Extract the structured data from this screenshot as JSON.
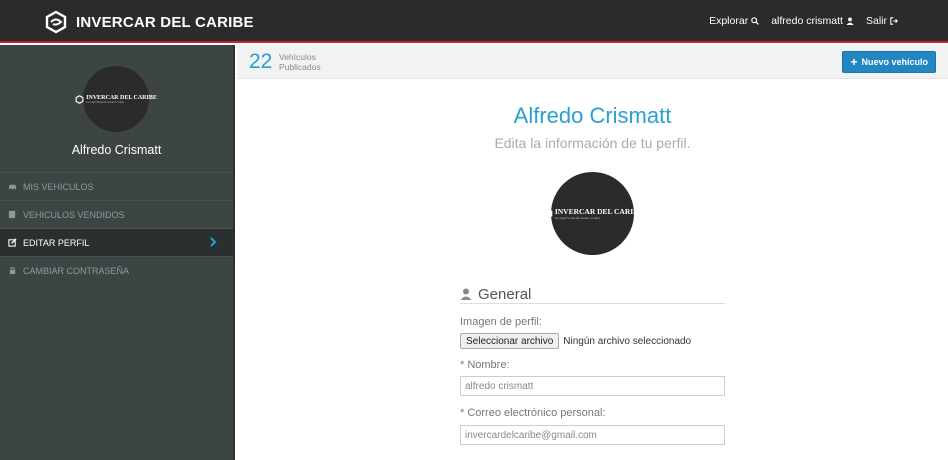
{
  "topbar": {
    "brand": "INVERCAR DEL CARIBE",
    "nav": {
      "explore": "Explorar",
      "user": "alfredo crismatt",
      "logout": "Salir"
    }
  },
  "sidebar": {
    "avatar_logo": {
      "main": "INVERCAR DEL CARIBE",
      "sub": "La mejor forma de vender tu carro"
    },
    "user_name": "Alfredo Crismatt",
    "items": [
      {
        "label": "MIS VEHICULOS",
        "icon": "car-icon"
      },
      {
        "label": "VEHICULOS VENDIDOS",
        "icon": "book-icon"
      },
      {
        "label": "EDITAR PERFIL",
        "icon": "edit-icon",
        "active": true
      },
      {
        "label": "CAMBIAR CONTRASEÑA",
        "icon": "lock-icon"
      }
    ]
  },
  "subheader": {
    "count": "22",
    "count_line1": "Vehículos",
    "count_line2": "Publicados",
    "new_button": "Nuevo vehículo"
  },
  "profile": {
    "name": "Alfredo Crismatt",
    "subtitle": "Edita la información de tu perfil.",
    "logo": {
      "main": "INVERCAR DEL CARIBE",
      "sub": "La mejor forma de vender tu carro"
    }
  },
  "form": {
    "section_title": "General",
    "image_label": "Imagen de perfil:",
    "file_button": "Seleccionar archivo",
    "file_status": "Ningún archivo seleccionado",
    "name_label": "* Nombre:",
    "name_value": "alfredo crismatt",
    "email_label": "* Correo electrónico personal:",
    "email_value": "invercardelcaribe@gmail.com"
  },
  "colors": {
    "accent": "#2a9fd6",
    "topbar_border": "#c0262d",
    "sidebar": "#3d4444",
    "button": "#2286c3"
  }
}
